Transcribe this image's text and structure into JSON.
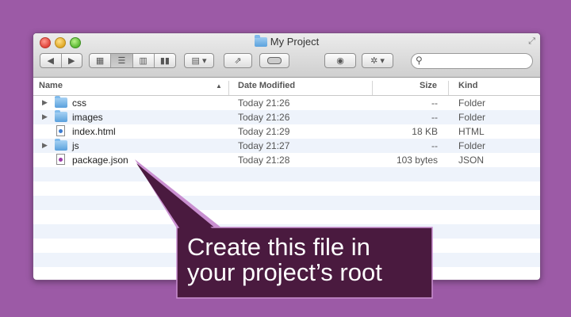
{
  "window": {
    "title": "My Project"
  },
  "toolbar": {
    "back_icon": "back-arrow-icon",
    "forward_icon": "forward-arrow-icon",
    "view_icons": [
      "icon-view-icon",
      "list-view-icon",
      "column-view-icon",
      "coverflow-view-icon"
    ],
    "active_view": "list",
    "arrange_icon": "arrange-menu-icon",
    "share_icon": "share-icon",
    "tag_icon": "tag-icon",
    "quicklook_icon": "eye-icon",
    "action_icon": "gear-icon",
    "search_placeholder": ""
  },
  "columns": {
    "name": "Name",
    "date": "Date Modified",
    "size": "Size",
    "kind": "Kind"
  },
  "files": [
    {
      "name": "css",
      "date": "Today 21:26",
      "size": "--",
      "kind": "Folder",
      "icon": "folder-icon",
      "expandable": true
    },
    {
      "name": "images",
      "date": "Today 21:26",
      "size": "--",
      "kind": "Folder",
      "icon": "folder-icon",
      "expandable": true
    },
    {
      "name": "index.html",
      "date": "Today 21:29",
      "size": "18 KB",
      "kind": "HTML",
      "icon": "html-file-icon",
      "expandable": false
    },
    {
      "name": "js",
      "date": "Today 21:27",
      "size": "--",
      "kind": "Folder",
      "icon": "folder-icon",
      "expandable": true
    },
    {
      "name": "package.json",
      "date": "Today 21:28",
      "size": "103 bytes",
      "kind": "JSON",
      "icon": "json-file-icon",
      "expandable": false
    }
  ],
  "callout": {
    "line1": "Create this file in",
    "line2": "your project’s root"
  },
  "colors": {
    "background": "#9c5aa6",
    "callout_fill": "#4a1a3f",
    "callout_border": "#c98fd0"
  }
}
